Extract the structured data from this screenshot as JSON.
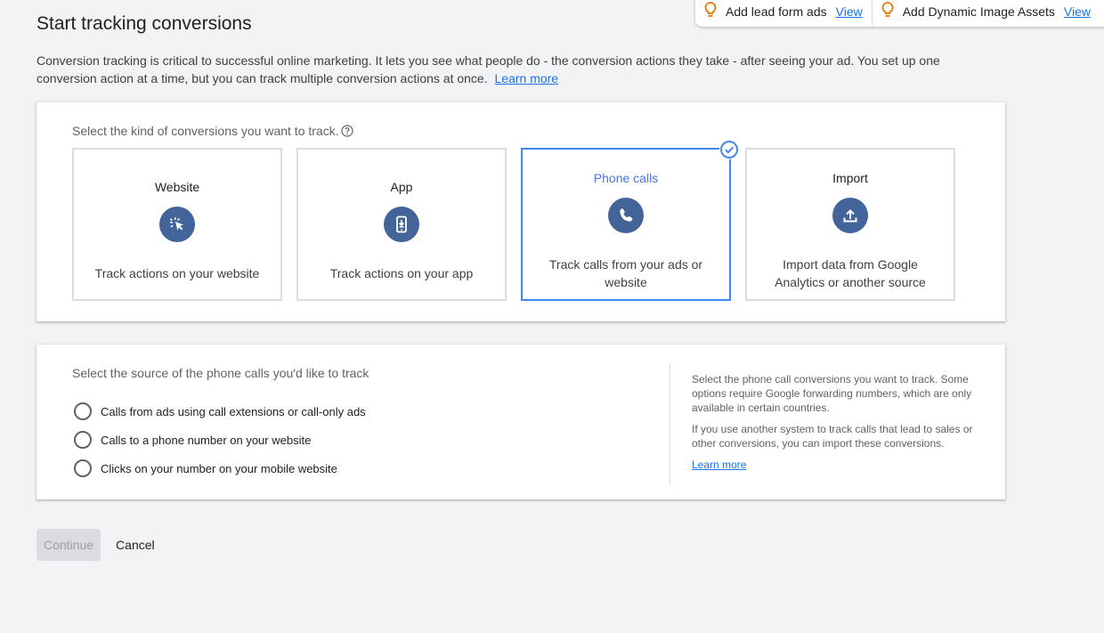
{
  "suggestions": [
    {
      "label": "Add lead form ads",
      "link": "View",
      "icon": "lightbulb-icon"
    },
    {
      "label": "Add Dynamic Image Assets",
      "link": "View",
      "icon": "lightbulb-icon"
    }
  ],
  "colors": {
    "accent": "#1a73e8",
    "selected_border": "#4285f4",
    "icon_circle": "#426499",
    "bulb": "#e37400"
  },
  "page": {
    "title": "Start tracking conversions",
    "intro": "Conversion tracking is critical to successful online marketing. It lets you see what people do - the conversion actions they take - after seeing your ad. You set up one conversion action at a time, but you can track multiple conversion actions at once.",
    "intro_link": "Learn more"
  },
  "kind_section": {
    "label": "Select the kind of conversions you want to track.",
    "help_icon": "help-circle-icon",
    "selected": "Phone calls",
    "tiles": [
      {
        "title": "Website",
        "icon": "cursor-click-icon",
        "description": "Track actions on your website",
        "selected": false
      },
      {
        "title": "App",
        "icon": "phone-download-icon",
        "description": "Track actions on your app",
        "selected": false
      },
      {
        "title": "Phone calls",
        "icon": "phone-icon",
        "description": "Track calls from your ads or website",
        "selected": true
      },
      {
        "title": "Import",
        "icon": "upload-icon",
        "description": "Import data from Google Analytics or another source",
        "selected": false
      }
    ]
  },
  "source_section": {
    "label": "Select the source of the phone calls you'd like to track",
    "options": [
      {
        "label": "Calls from ads using call extensions or call-only ads",
        "checked": false
      },
      {
        "label": "Calls to a phone number on your website",
        "checked": false
      },
      {
        "label": "Clicks on your number on your mobile website",
        "checked": false
      }
    ],
    "help": {
      "p1": "Select the phone call conversions you want to track. Some options require Google forwarding numbers, which are only available in certain countries.",
      "p2": "If you use another system to track calls that lead to sales or other conversions, you can import these conversions.",
      "link": "Learn more"
    }
  },
  "actions": {
    "continue_label": "Continue",
    "continue_disabled": true,
    "cancel_label": "Cancel"
  }
}
